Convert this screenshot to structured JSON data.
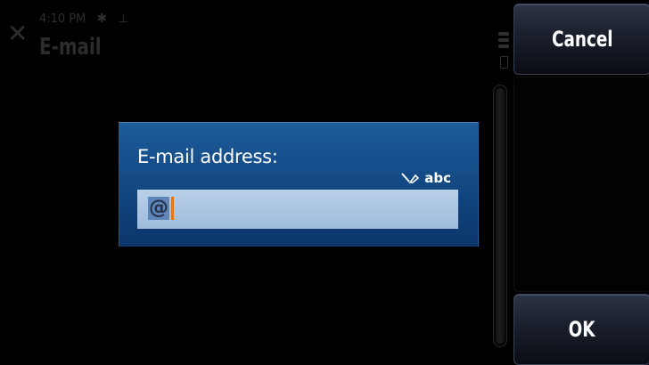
{
  "status_bar": {
    "time": "4:10 PM",
    "bluetooth_icon": "bluetooth-icon",
    "usb_icon": "usb-icon"
  },
  "background": {
    "title": "E-mail"
  },
  "softkeys": {
    "cancel_label": "Cancel",
    "ok_label": "OK"
  },
  "dialog": {
    "label": "E-mail address:",
    "input_mode": "abc",
    "input_value": "@"
  },
  "colors": {
    "dialog_blue": "#134a86",
    "field_blue": "#a8c3e1",
    "cursor": "#e07818",
    "softkey": "#1a1f2c"
  }
}
